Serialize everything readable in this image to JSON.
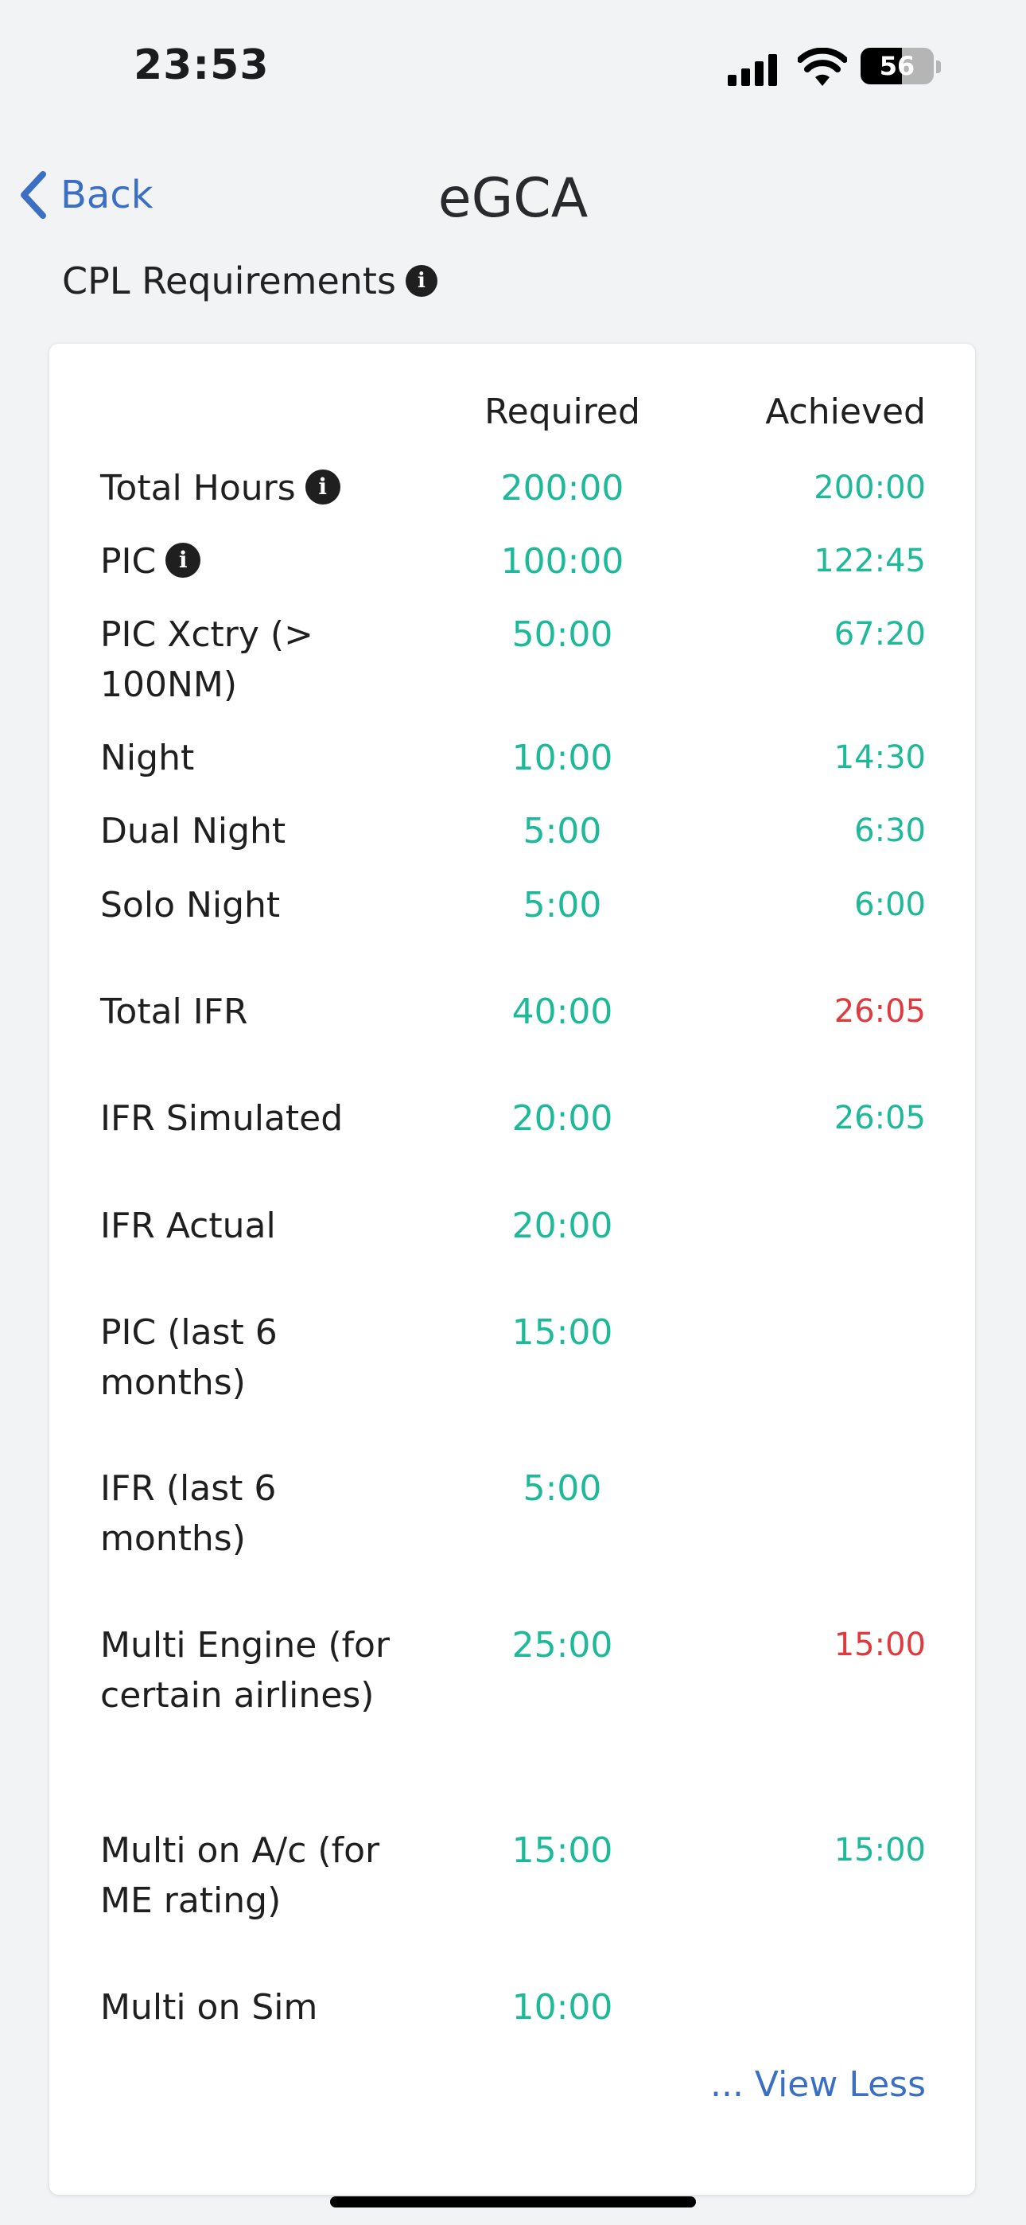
{
  "status": {
    "time": "23:53",
    "battery": "56",
    "battery_level": 0.56
  },
  "nav": {
    "back_label": "Back",
    "title": "eGCA"
  },
  "section": {
    "title": "CPL Requirements"
  },
  "table": {
    "headers": {
      "required": "Required",
      "achieved": "Achieved"
    },
    "rows": [
      {
        "label": "Total Hours",
        "info": true,
        "required": "200:00",
        "achieved": "200:00",
        "achieved_status": "met"
      },
      {
        "label": "PIC",
        "info": true,
        "required": "100:00",
        "achieved": "122:45",
        "achieved_status": "met"
      },
      {
        "label": "PIC Xctry (> 100NM)",
        "info": false,
        "required": "50:00",
        "achieved": "67:20",
        "achieved_status": "met"
      },
      {
        "label": "Night",
        "info": false,
        "required": "10:00",
        "achieved": "14:30",
        "achieved_status": "met"
      },
      {
        "label": "Dual Night",
        "info": false,
        "required": "5:00",
        "achieved": "6:30",
        "achieved_status": "met"
      },
      {
        "label": "Solo Night",
        "info": false,
        "required": "5:00",
        "achieved": "6:00",
        "achieved_status": "met"
      },
      {
        "label": "Total IFR",
        "info": false,
        "required": "40:00",
        "achieved": "26:05",
        "achieved_status": "unmet"
      },
      {
        "label": "IFR Simulated",
        "info": false,
        "required": "20:00",
        "achieved": "26:05",
        "achieved_status": "met"
      },
      {
        "label": "IFR Actual",
        "info": false,
        "required": "20:00",
        "achieved": "",
        "achieved_status": ""
      },
      {
        "label": "PIC (last 6 months)",
        "info": false,
        "required": "15:00",
        "achieved": "",
        "achieved_status": ""
      },
      {
        "label": "IFR (last 6 months)",
        "info": false,
        "required": "5:00",
        "achieved": "",
        "achieved_status": ""
      },
      {
        "label": "Multi Engine (for certain airlines)",
        "info": false,
        "required": "25:00",
        "achieved": "15:00",
        "achieved_status": "unmet"
      },
      {
        "label": "Multi on A/c (for ME rating)",
        "info": false,
        "required": "15:00",
        "achieved": "15:00",
        "achieved_status": "met"
      },
      {
        "label": "Multi on Sim",
        "info": false,
        "required": "10:00",
        "achieved": "",
        "achieved_status": ""
      }
    ],
    "view_less_label": "... View Less"
  },
  "colors": {
    "accent": "#3b6fc4",
    "met": "#1db999",
    "unmet": "#e03a3e"
  }
}
